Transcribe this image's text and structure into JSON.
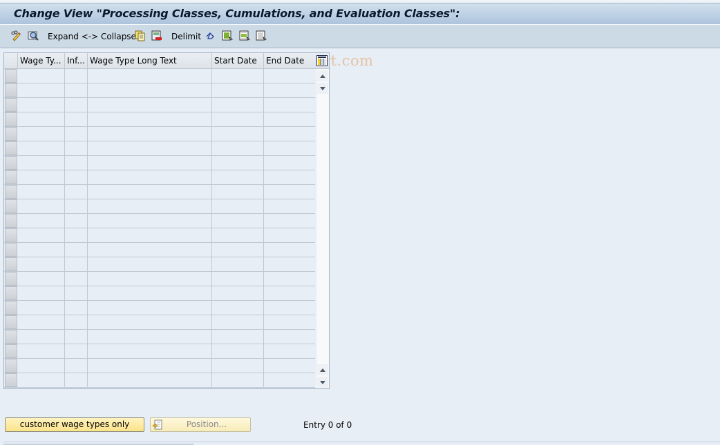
{
  "title": "Change View \"Processing Classes, Cumulations, and Evaluation Classes\":",
  "toolbar": {
    "icons": [
      "display-change-icon",
      "details-icon"
    ],
    "expand_collapse_label": "Expand <-> Collapse",
    "icons2": [
      "copy-as-icon",
      "delete-icon"
    ],
    "delimit_label": "Delimit",
    "icons3": [
      "undo-change-icon",
      "select-all-icon",
      "select-block-icon",
      "deselect-all-icon"
    ]
  },
  "watermark": "© www.tutorialkart.com",
  "grid": {
    "columns": [
      {
        "label": "Wage Ty..."
      },
      {
        "label": "Inf..."
      },
      {
        "label": "Wage Type Long Text"
      },
      {
        "label": "Start Date"
      },
      {
        "label": "End Date"
      }
    ],
    "row_count": 22,
    "rows": []
  },
  "footer": {
    "customer_button_label": "customer wage types only",
    "position_button_label": "Position...",
    "entry_text": "Entry 0 of 0"
  }
}
